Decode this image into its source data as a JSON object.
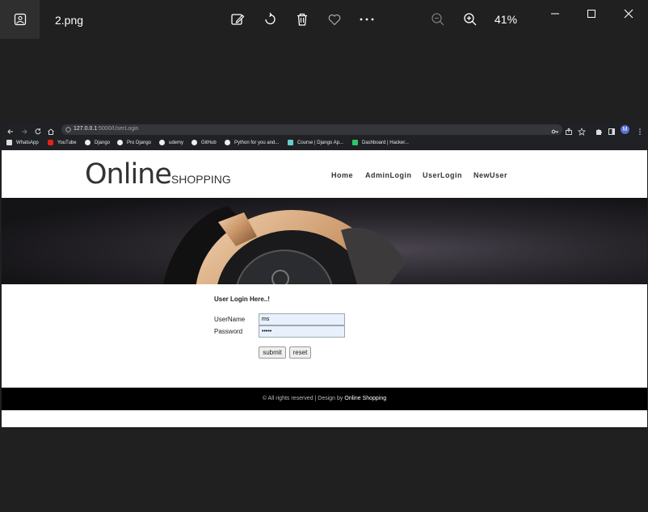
{
  "viewer": {
    "filename": "2.png",
    "zoom": "41%"
  },
  "browser": {
    "url_host": "127.0.0.1",
    "url_path": ":5000/UserLogin",
    "bookmarks": [
      "WhatsApp",
      "YouTube",
      "Django",
      "Pro Django",
      "udemy",
      "GitHub",
      "Python for you and...",
      "Course | Django Ap...",
      "Dashboard | Hacker..."
    ],
    "profile_initial": "M"
  },
  "site": {
    "logo_big": "Online",
    "logo_small": "SHOPPING",
    "nav": [
      "Home",
      "AdminLogin",
      "UserLogin",
      "NewUser"
    ]
  },
  "login": {
    "title": "User Login Here..!",
    "username_label": "UserName",
    "username_value": "ms",
    "password_label": "Password",
    "password_value": "•••••",
    "submit_label": "submit",
    "reset_label": "reset"
  },
  "footer": {
    "text": "© All rights reserved | Design by ",
    "brand": "Online Shopping"
  }
}
